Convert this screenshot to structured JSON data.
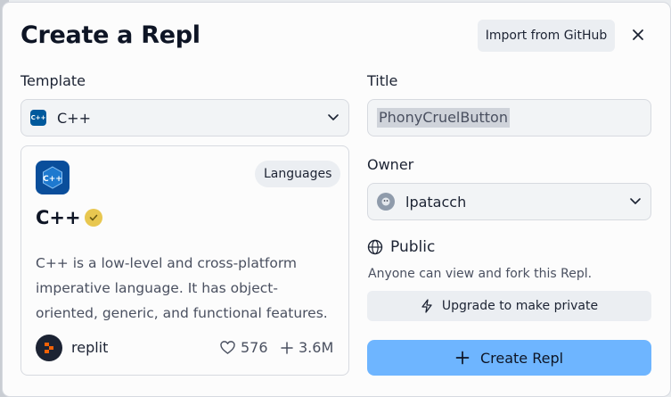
{
  "modal": {
    "title": "Create a Repl",
    "import_label": "Import from GitHub"
  },
  "template": {
    "label": "Template",
    "selected": "C++",
    "card": {
      "badge": "Languages",
      "name": "C++",
      "description": "C++ is a low-level and cross-platform imperative language. It has object-oriented, generic, and functional features.",
      "author": "replit",
      "likes": "576",
      "forks": "3.6M",
      "logo_text": "C++"
    }
  },
  "title_field": {
    "label": "Title",
    "value": "PhonyCruelButton"
  },
  "owner": {
    "label": "Owner",
    "selected": "lpatacch"
  },
  "visibility": {
    "label": "Public",
    "description": "Anyone can view and fork this Repl.",
    "upgrade_label": "Upgrade to make private"
  },
  "create_label": "Create Repl",
  "icons": {
    "close": "close-icon",
    "chevron": "chevron-down-icon",
    "globe": "globe-icon",
    "bolt": "bolt-icon",
    "heart": "heart-icon",
    "plus": "plus-icon",
    "verified": "verified-check-icon"
  },
  "colors": {
    "primary_button": "#6eb5ff",
    "cpp_logo": "#0a4e9b",
    "verified_badge": "#e8c750"
  }
}
